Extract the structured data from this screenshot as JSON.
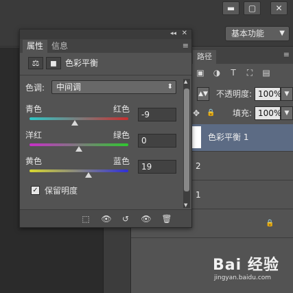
{
  "window": {
    "minimize": "▬",
    "restore": "▢",
    "close": "✕"
  },
  "options_bar": {
    "workspace": "基本功能",
    "workspace_caret": "▼"
  },
  "layers_panel": {
    "tab_label": "路径",
    "menu": "≡",
    "icons": [
      "▣",
      "◑",
      "T",
      "⛶",
      "▤"
    ],
    "blend_mode_value": "",
    "opacity_label": "不透明度:",
    "opacity_value": "100%",
    "lock_move_icon": "✥",
    "lock_icon": "🔒",
    "fill_label": "填充:",
    "fill_value": "100%",
    "layers": [
      {
        "name": "色彩平衡 1",
        "selected": true
      },
      {
        "name": "2",
        "selected": false
      },
      {
        "name": "1",
        "selected": false
      },
      {
        "name": "",
        "locked": true,
        "lock_glyph": "🔒"
      }
    ]
  },
  "properties_panel": {
    "collapse": "◂◂",
    "close": "✕",
    "tabs": [
      {
        "label": "属性",
        "active": true
      },
      {
        "label": "信息",
        "active": false
      }
    ],
    "tab_menu": "≡",
    "header_title": "色彩平衡",
    "header_icons": [
      "⚖",
      "◼"
    ],
    "tone_label": "色调:",
    "tone_value": "中间调",
    "tone_arrow": "⬍",
    "sliders": [
      {
        "left": "青色",
        "right": "红色",
        "value": "-9",
        "level": -9,
        "track_colors": [
          "#2fc8c8",
          "#c82f2f"
        ]
      },
      {
        "left": "洋红",
        "right": "绿色",
        "value": "0",
        "level": 0,
        "track_colors": [
          "#c82fc8",
          "#2fc82f"
        ]
      },
      {
        "left": "黄色",
        "right": "蓝色",
        "value": "19",
        "level": 19,
        "track_colors": [
          "#d8d82f",
          "#2f2fd8"
        ]
      }
    ],
    "preserve_label": "保留明度",
    "preserve_checked": true,
    "footer_icons": [
      "⬚",
      "👁",
      "↺",
      "👁",
      "🗑"
    ]
  },
  "watermark": {
    "logo": "Bai 经验",
    "url": "jingyan.baidu.com"
  }
}
